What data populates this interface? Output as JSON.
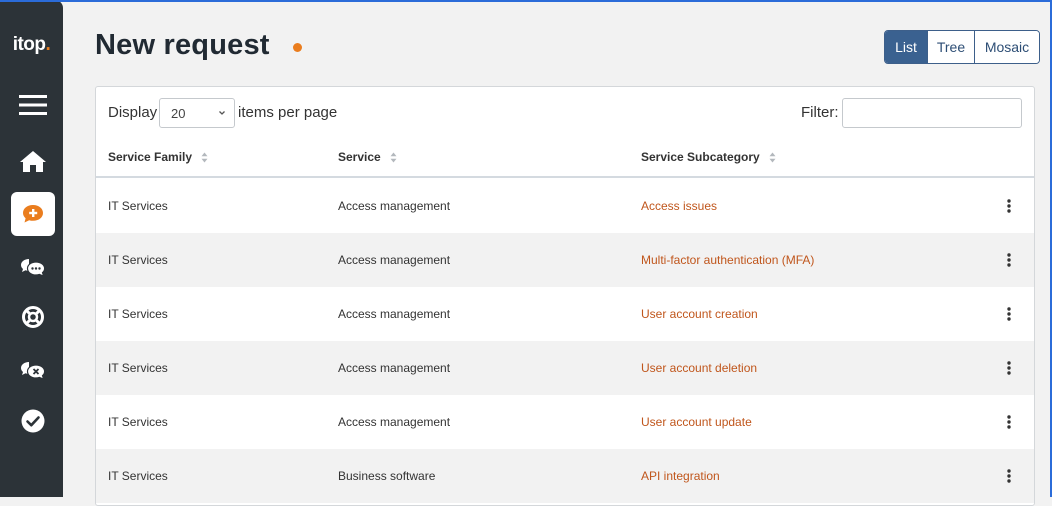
{
  "app": {
    "logo_text": "itop",
    "logo_dot": "."
  },
  "sidebar": {
    "items": [
      {
        "icon": "menu-icon"
      },
      {
        "icon": "home-icon"
      },
      {
        "icon": "new-request-icon",
        "active": true
      },
      {
        "icon": "chat-bubbles-icon"
      },
      {
        "icon": "lifebuoy-icon"
      },
      {
        "icon": "closed-chat-icon"
      },
      {
        "icon": "check-circle-icon"
      }
    ]
  },
  "header": {
    "title": "New request",
    "views": [
      "List",
      "Tree",
      "Mosaic"
    ],
    "active_view": "List"
  },
  "list": {
    "display_label": "Display",
    "page_size": "20",
    "per_page_label": "items per page",
    "filter_label": "Filter:",
    "filter_value": "",
    "columns": [
      "Service Family",
      "Service",
      "Service Subcategory"
    ],
    "rows": [
      {
        "family": "IT Services",
        "service": "Access management",
        "subcategory": "Access issues"
      },
      {
        "family": "IT Services",
        "service": "Access management",
        "subcategory": "Multi-factor authentication (MFA)"
      },
      {
        "family": "IT Services",
        "service": "Access management",
        "subcategory": "User account creation"
      },
      {
        "family": "IT Services",
        "service": "Access management",
        "subcategory": "User account deletion"
      },
      {
        "family": "IT Services",
        "service": "Access management",
        "subcategory": "User account update"
      },
      {
        "family": "IT Services",
        "service": "Business software",
        "subcategory": "API integration"
      }
    ]
  },
  "colors": {
    "sidebar_bg": "#2c3338",
    "accent_orange": "#ea7d1e",
    "link": "#c0561c",
    "toggle_active": "#3a6190"
  }
}
